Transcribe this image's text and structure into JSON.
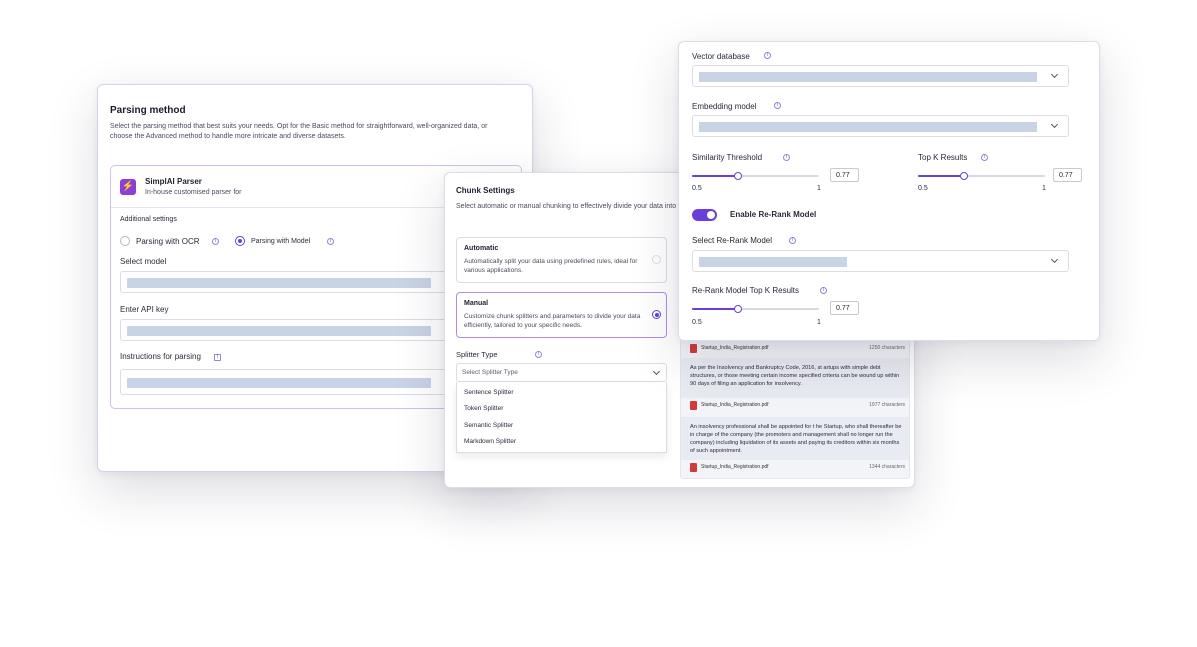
{
  "parsing": {
    "title": "Parsing method",
    "description": "Select the parsing method that best suits your needs. Opt for the Basic method for straightforward, well-organized data, or choose the Advanced method to handle more intricate and diverse datasets.",
    "parser_name": "SimplAI Parser",
    "parser_sub": "In-house customised parser for",
    "additional_settings": "Additional settings",
    "option_ocr": "Parsing with OCR",
    "option_model": "Parsing with Model",
    "select_model_label": "Select model",
    "api_key_label": "Enter API key",
    "instructions_label": "Instructions for parsing"
  },
  "chunk": {
    "title": "Chunk Settings",
    "description": "Select automatic or manual chunking to effectively divide your data into",
    "automatic_title": "Automatic",
    "automatic_desc": "Automatically split your data using predefined rules, ideal for various applications.",
    "manual_title": "Manual",
    "manual_desc": "Customize chunk splitters and parameters to divide your data efficiently, tailored to your specific needs.",
    "splitter_label": "Splitter Type",
    "splitter_placeholder": "Select Splitter Type",
    "splitter_options": [
      "Sentence Splitter",
      "Token Splitter",
      "Semantic Splitter",
      "Markdown Splitter"
    ]
  },
  "preview": {
    "files": [
      {
        "name": "Startup_India_Registration.pdf",
        "chars": "1250 characters"
      },
      {
        "name": "Startup_India_Registration.pdf",
        "chars": "1977 characters"
      },
      {
        "name": "Startup_India_Registration.pdf",
        "chars": "1344 characters"
      }
    ],
    "chunks": [
      "As per the Insolvency and Bankruptcy Code, 2016, st artups with simple debt structures, or those meeting certain income specified criteria can be wound up within 90 days of filing an application for insolvency.",
      "An insolvency professional shall be appointed for t he Startup, who shall thereafter be in charge of the company (the promoters and management shall no longer run the company) including liquidation of its assets and paying its creditors within six months of such appointment."
    ]
  },
  "vector": {
    "vector_db_label": "Vector database",
    "embedding_label": "Embedding model",
    "similarity_label": "Similarity Threshold",
    "similarity_value": "0.77",
    "similarity_min": "0.5",
    "similarity_max": "1",
    "topk_label": "Top K Results",
    "topk_value": "0.77",
    "topk_min": "0.5",
    "topk_max": "1",
    "rerank_toggle_label": "Enable Re-Rank Model",
    "rerank_select_label": "Select Re-Rank Model",
    "rerank_topk_label": "Re-Rank Model Top K Results",
    "rerank_topk_value": "0.77",
    "rerank_topk_min": "0.5",
    "rerank_topk_max": "1"
  },
  "colors": {
    "accent": "#6a3fd8",
    "field_fill": "#c9d3e6",
    "pdf": "#d23a3a"
  }
}
